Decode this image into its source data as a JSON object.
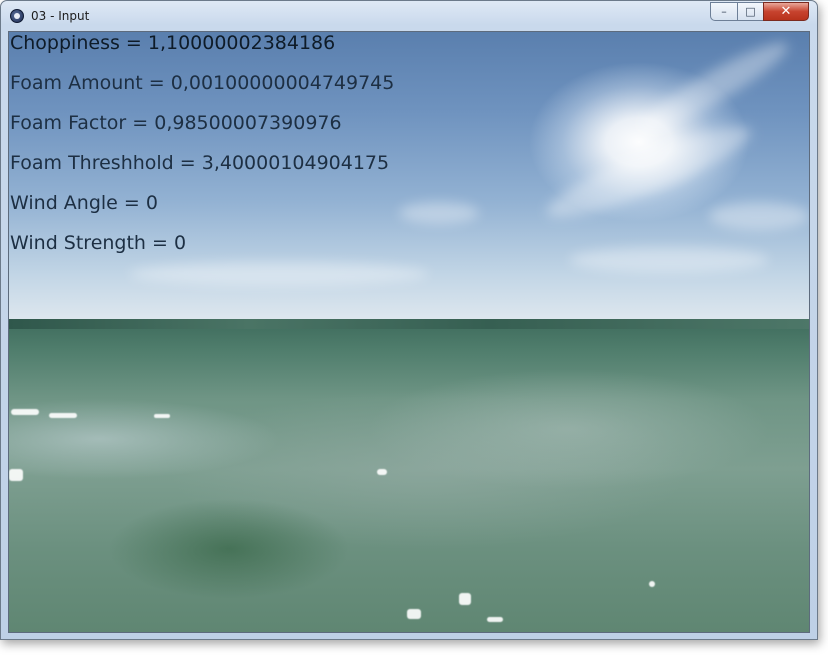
{
  "window": {
    "title": "03 - Input",
    "controls": {
      "minimize": "–",
      "maximize": "□",
      "close": "✕"
    }
  },
  "hud": {
    "lines": [
      "Choppiness = 1,10000002384186",
      "Foam Amount = 0,00100000004749745",
      "Foam Factor = 0,98500007390976",
      "Foam Threshhold = 3,40000104904175",
      "Wind Angle = 0",
      "Wind Strength = 0"
    ]
  },
  "colors": {
    "sky_top": "#5a7fae",
    "horizon": "#e9eff2",
    "sea": "#6f9585",
    "hud_text": "#1d2f43",
    "close_button": "#c7432e"
  },
  "icons": {
    "app": "ocean-app-icon"
  }
}
